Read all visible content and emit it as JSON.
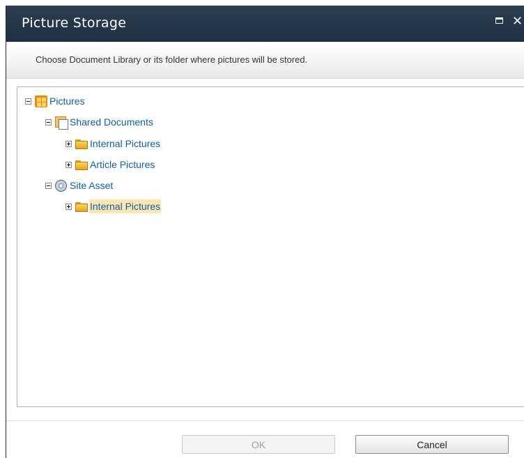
{
  "dialog": {
    "title": "Picture Storage",
    "description": "Choose Document Library or its folder where pictures will be stored."
  },
  "tree": {
    "root": {
      "label": "Pictures",
      "icon": "library-icon",
      "expanded": true,
      "children": [
        {
          "label": "Shared Documents",
          "icon": "document-library-icon",
          "expanded": true,
          "children": [
            {
              "label": "Internal Pictures",
              "icon": "folder-icon",
              "expanded": false
            },
            {
              "label": "Article Pictures",
              "icon": "folder-icon",
              "expanded": false
            }
          ]
        },
        {
          "label": "Site Asset",
          "icon": "asset-library-icon",
          "expanded": true,
          "children": [
            {
              "label": "Internal Pictures",
              "icon": "folder-icon",
              "expanded": false,
              "selected": true
            }
          ]
        }
      ]
    }
  },
  "buttons": {
    "ok": "OK",
    "cancel": "Cancel"
  },
  "colors": {
    "titlebar": "#2c3e50",
    "link": "#0b5fa7",
    "selection": "#fbe6b0",
    "tree_border": "#9db4d2"
  }
}
